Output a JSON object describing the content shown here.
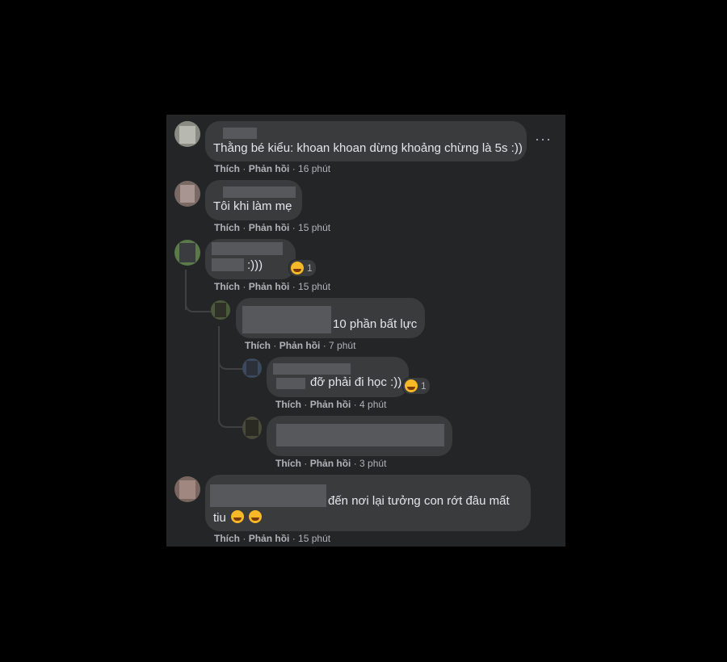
{
  "comments": [
    {
      "text": "Thằng bé kiểu: khoan khoan dừng khoảng chừng là 5s :))",
      "like": "Thích",
      "reply": "Phản hồi",
      "time": "16 phút"
    },
    {
      "text": "Tôi khi làm mẹ",
      "like": "Thích",
      "reply": "Phản hồi",
      "time": "15 phút"
    },
    {
      "text": ":)))",
      "like": "Thích",
      "reply": "Phản hồi",
      "time": "15 phút",
      "reaction_count": "1"
    },
    {
      "text": "10 phần bất lực",
      "like": "Thích",
      "reply": "Phản hồi",
      "time": "7 phút"
    },
    {
      "text": "đỡ phải đi học :))",
      "like": "Thích",
      "reply": "Phản hồi",
      "time": "4 phút",
      "reaction_count": "1"
    },
    {
      "text": "",
      "like": "Thích",
      "reply": "Phản hồi",
      "time": "3 phút"
    },
    {
      "text_line1": "đến nơi lại tưởng con rớt đâu mất",
      "text_line2": "tiu",
      "like": "Thích",
      "reply": "Phản hồi",
      "time": "15 phút"
    }
  ],
  "more_options_glyph": "···",
  "sep": "·",
  "icons": {
    "more": "more-horizontal-icon",
    "reaction": "haha-reaction-icon",
    "emoji": "rolling-laughing-emoji-icon"
  },
  "colors": {
    "background": "#000000",
    "panel": "#242526",
    "bubble": "#3a3b3c",
    "text": "#e4e6eb",
    "meta": "#b0b3b8"
  }
}
